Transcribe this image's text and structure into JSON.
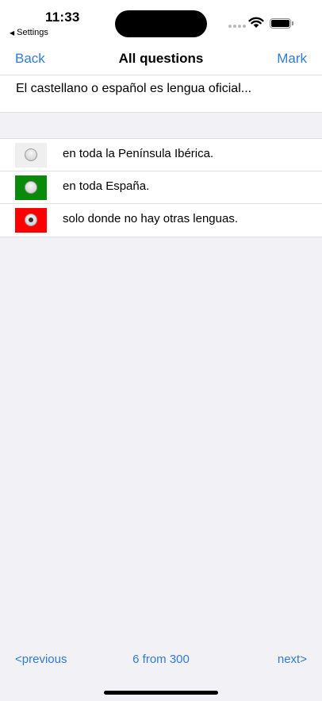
{
  "status_bar": {
    "time": "11:33",
    "back_app_label": "Settings",
    "back_app_icon": "back-triangle-icon",
    "signal_icon": "cellular-signal-icon",
    "wifi_icon": "wifi-icon",
    "battery_icon": "battery-icon"
  },
  "nav": {
    "back_label": "Back",
    "title": "All questions",
    "mark_label": "Mark",
    "accent_color": "#2f7cd3"
  },
  "question": {
    "text": "El castellano o español es lengua oficial..."
  },
  "answers": [
    {
      "text": "en toda la Península Ibérica.",
      "swatch_color": "#efefef",
      "selected": false
    },
    {
      "text": "en toda España.",
      "swatch_color": "#0a8a0a",
      "selected": false
    },
    {
      "text": "solo donde no hay otras lenguas.",
      "swatch_color": "#ff0000",
      "selected": true
    }
  ],
  "footer": {
    "previous_label": "<previous",
    "position_label": "6 from 300",
    "next_label": "next>"
  }
}
